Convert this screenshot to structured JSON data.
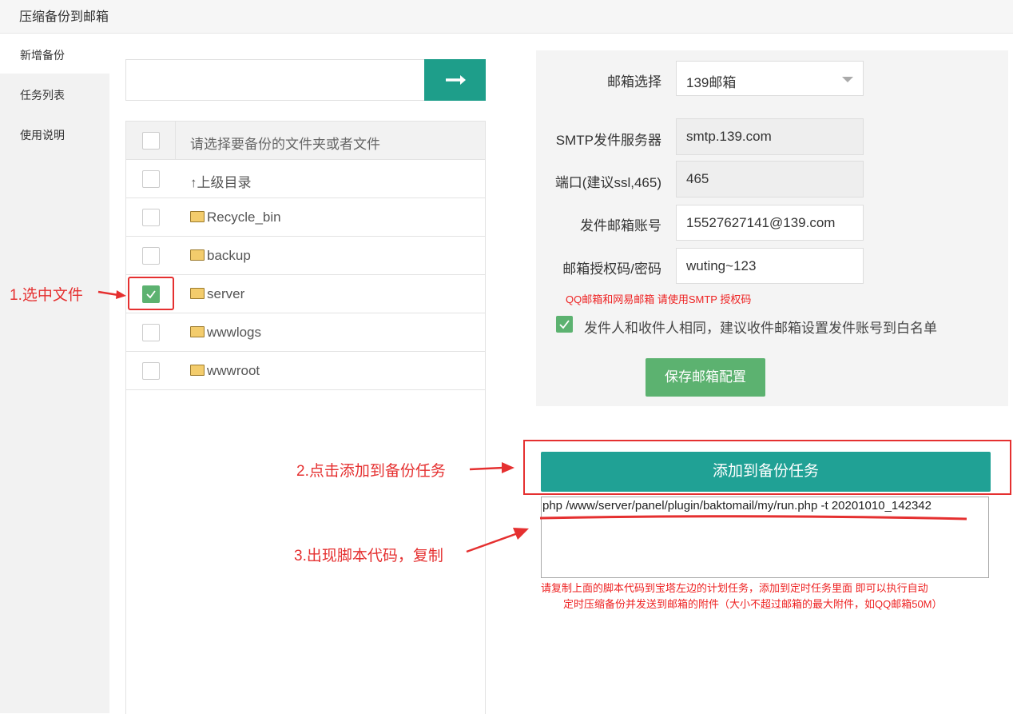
{
  "window": {
    "title": "压缩备份到邮箱"
  },
  "sidebar": {
    "items": [
      {
        "label": "新增备份"
      },
      {
        "label": "任务列表"
      },
      {
        "label": "使用说明"
      }
    ]
  },
  "path_bar": {
    "value": "",
    "go_icon": "arrow-right-icon"
  },
  "file_list": {
    "header": "请选择要备份的文件夹或者文件",
    "rows": [
      {
        "label": "↑上级目录",
        "type": "parent",
        "checked": false
      },
      {
        "label": "Recycle_bin",
        "type": "folder",
        "checked": false
      },
      {
        "label": "backup",
        "type": "folder",
        "checked": false
      },
      {
        "label": "server",
        "type": "folder",
        "checked": true
      },
      {
        "label": "wwwlogs",
        "type": "folder",
        "checked": false
      },
      {
        "label": "wwwroot",
        "type": "folder",
        "checked": false
      }
    ]
  },
  "email_config": {
    "mailbox_label": "邮箱选择",
    "mailbox_value": "139邮箱",
    "smtp_label": "SMTP发件服务器",
    "smtp_value": "smtp.139.com",
    "port_label": "端口(建议ssl,465)",
    "port_value": "465",
    "account_label": "发件邮箱账号",
    "account_value": "15527627141@139.com",
    "password_label": "邮箱授权码/密码",
    "password_value": "wuting~123",
    "smtp_hint": "QQ邮箱和网易邮箱 请使用SMTP 授权码",
    "same_sender_checked": true,
    "same_sender_text": "发件人和收件人相同，建议收件邮箱设置发件账号到白名单",
    "save_button": "保存邮箱配置"
  },
  "task": {
    "add_button": "添加到备份任务",
    "command": "php /www/server/panel/plugin/baktomail/my/run.php -t 20201010_142342",
    "notice_line1": "请复制上面的脚本代码到宝塔左边的计划任务，添加到定时任务里面 即可以执行自动",
    "notice_line2": "定时压缩备份并发送到邮箱的附件（大小不超过邮箱的最大附件，如QQ邮箱50M）"
  },
  "annotations": {
    "step1": "1.选中文件",
    "step2": "2.点击添加到备份任务",
    "step3": "3.出现脚本代码，复制"
  },
  "colors": {
    "accent": "#20a195",
    "success": "#5cb270",
    "annotation": "#e53030"
  }
}
